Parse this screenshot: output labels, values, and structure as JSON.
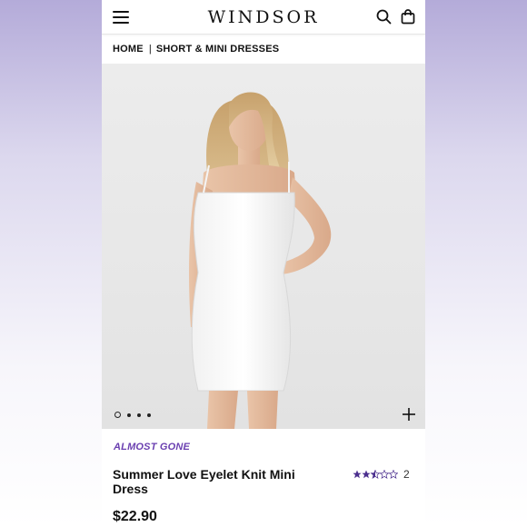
{
  "header": {
    "logo": "WINDSOR",
    "menu_icon": "hamburger-menu-icon",
    "search_icon": "search-icon",
    "bag_icon": "shopping-bag-icon"
  },
  "breadcrumb": {
    "items": [
      "HOME",
      "SHORT & MINI DRESSES"
    ],
    "separator": "|"
  },
  "gallery": {
    "image_description": "product-photo-model-white-dress",
    "dot_count": 4,
    "active_dot": 0,
    "zoom_icon": "plus-icon"
  },
  "product": {
    "badge": "ALMOST GONE",
    "title": "Summer Love Eyelet Knit Mini Dress",
    "rating": 2.5,
    "rating_max": 5,
    "review_count": "2",
    "price": "$22.90"
  },
  "colors": {
    "badge": "#6a3fb0",
    "star": "#4b2f8e",
    "text": "#111111"
  }
}
